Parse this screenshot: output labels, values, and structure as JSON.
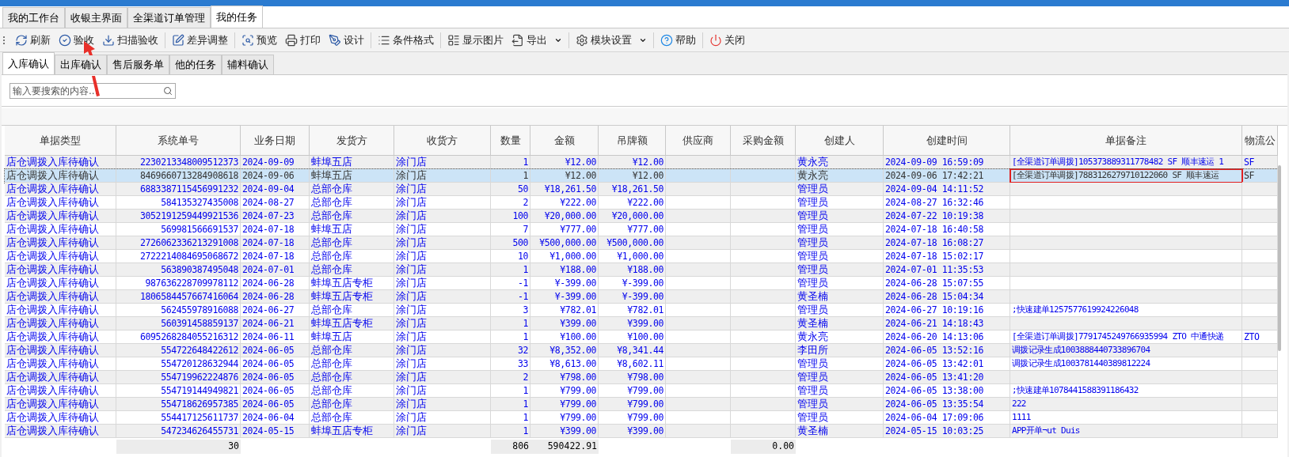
{
  "main_tabs": [
    {
      "label": "我的工作台",
      "selected": false
    },
    {
      "label": "收银主界面",
      "selected": false
    },
    {
      "label": "全渠道订单管理",
      "selected": false
    },
    {
      "label": "我的任务",
      "selected": true
    }
  ],
  "toolbar": [
    {
      "label": "刷新"
    },
    {
      "label": "验收"
    },
    {
      "label": "扫描验收"
    },
    {
      "label": "差异调整"
    },
    {
      "label": "预览"
    },
    {
      "label": "打印"
    },
    {
      "label": "设计"
    },
    {
      "label": "条件格式"
    },
    {
      "label": "显示图片"
    },
    {
      "label": "导出",
      "dropdown": true
    },
    {
      "label": "模块设置",
      "dropdown": true
    },
    {
      "label": "帮助"
    },
    {
      "label": "关闭"
    }
  ],
  "sub_tabs": [
    {
      "label": "入库确认",
      "selected": true
    },
    {
      "label": "出库确认",
      "selected": false
    },
    {
      "label": "售后服务单",
      "selected": false
    },
    {
      "label": "他的任务",
      "selected": false
    },
    {
      "label": "辅料确认",
      "selected": false
    }
  ],
  "search": {
    "placeholder": "输入要搜索的内容..."
  },
  "table": {
    "columns": [
      "单据类型",
      "系统单号",
      "业务日期",
      "发货方",
      "收货方",
      "数量",
      "金额",
      "吊牌额",
      "供应商",
      "采购金额",
      "创建人",
      "创建时间",
      "单据备注",
      "物流公"
    ],
    "rows": [
      {
        "selected": false,
        "cells": [
          "店仓调拨入库待确认",
          "2230213348009512373",
          "2024-09-09",
          "蚌埠五店",
          "涂门店",
          "1",
          "¥12.00",
          "¥12.00",
          null,
          null,
          "黄永亮",
          "2024-09-09 16:59:09",
          "[全渠道订单调拨]105373889311778482 SF 顺丰速运 1",
          "SF"
        ]
      },
      {
        "selected": true,
        "highlight_note": true,
        "cells": [
          "店仓调拨入库待确认",
          "8469660713284908618",
          "2024-09-06",
          "蚌埠五店",
          "涂门店",
          "1",
          "¥12.00",
          "¥12.00",
          null,
          null,
          "黄永亮",
          "2024-09-06 17:42:21",
          "[全渠道订单调拨]7883126279710122060 SF 顺丰速运",
          "SF"
        ]
      },
      {
        "selected": false,
        "cells": [
          "店仓调拨入库待确认",
          "6883387115456991232",
          "2024-09-04",
          "总部仓库",
          "涂门店",
          "50",
          "¥18,261.50",
          "¥18,261.50",
          null,
          null,
          "管理员",
          "2024-09-04 14:11:52",
          null,
          null
        ]
      },
      {
        "selected": false,
        "cells": [
          "店仓调拨入库待确认",
          "584135327435008",
          "2024-08-27",
          "总部仓库",
          "涂门店",
          "2",
          "¥222.00",
          "¥222.00",
          null,
          null,
          "管理员",
          "2024-08-27 16:32:46",
          null,
          null
        ]
      },
      {
        "selected": false,
        "cells": [
          "店仓调拨入库待确认",
          "3052191259449921536",
          "2024-07-23",
          "总部仓库",
          "涂门店",
          "100",
          "¥20,000.00",
          "¥20,000.00",
          null,
          null,
          "管理员",
          "2024-07-22 10:19:38",
          null,
          null
        ]
      },
      {
        "selected": false,
        "cells": [
          "店仓调拨入库待确认",
          "569981566691537",
          "2024-07-18",
          "蚌埠五店",
          "涂门店",
          "7",
          "¥777.00",
          "¥777.00",
          null,
          null,
          "管理员",
          "2024-07-18 16:40:58",
          null,
          null
        ]
      },
      {
        "selected": false,
        "cells": [
          "店仓调拨入库待确认",
          "2726062336213291008",
          "2024-07-18",
          "总部仓库",
          "涂门店",
          "500",
          "¥500,000.00",
          "¥500,000.00",
          null,
          null,
          "管理员",
          "2024-07-18 16:08:27",
          null,
          null
        ]
      },
      {
        "selected": false,
        "cells": [
          "店仓调拨入库待确认",
          "2722214084695068672",
          "2024-07-18",
          "总部仓库",
          "涂门店",
          "10",
          "¥1,000.00",
          "¥1,000.00",
          null,
          null,
          "管理员",
          "2024-07-18 15:02:17",
          null,
          null
        ]
      },
      {
        "selected": false,
        "cells": [
          "店仓调拨入库待确认",
          "563890387495048",
          "2024-07-01",
          "总部仓库",
          "涂门店",
          "1",
          "¥188.00",
          "¥188.00",
          null,
          null,
          "管理员",
          "2024-07-01 11:35:53",
          null,
          null
        ]
      },
      {
        "selected": false,
        "cells": [
          "店仓调拨入库待确认",
          "987636228709978112",
          "2024-06-28",
          "蚌埠五店专柜",
          "涂门店",
          "-1",
          "¥-399.00",
          "¥-399.00",
          null,
          null,
          "管理员",
          "2024-06-28 15:07:55",
          null,
          null
        ]
      },
      {
        "selected": false,
        "cells": [
          "店仓调拨入库待确认",
          "1806584457667416064",
          "2024-06-28",
          "蚌埠五店专柜",
          "涂门店",
          "-1",
          "¥-399.00",
          "¥-399.00",
          null,
          null,
          "黄圣楠",
          "2024-06-28 15:04:34",
          null,
          null
        ]
      },
      {
        "selected": false,
        "cells": [
          "店仓调拨入库待确认",
          "562455978916088",
          "2024-06-27",
          "总部仓库",
          "涂门店",
          "3",
          "¥782.01",
          "¥782.01",
          null,
          null,
          "管理员",
          "2024-06-27 10:19:16",
          ";快速建单1257577619924226048",
          null
        ]
      },
      {
        "selected": false,
        "cells": [
          "店仓调拨入库待确认",
          "560391458859137",
          "2024-06-21",
          "蚌埠五店专柜",
          "涂门店",
          "1",
          "¥399.00",
          "¥399.00",
          null,
          null,
          "黄圣楠",
          "2024-06-21 14:18:43",
          null,
          null
        ]
      },
      {
        "selected": false,
        "cells": [
          "店仓调拨入库待确认",
          "6095268284055216312",
          "2024-06-11",
          "蚌埠五店",
          "涂门店",
          "1",
          "¥100.00",
          "¥100.00",
          null,
          null,
          "黄永亮",
          "2024-06-20 14:13:06",
          "[全渠道订单调拨]7791745249766935994 ZTO 中通快递",
          "ZTO"
        ]
      },
      {
        "selected": false,
        "cells": [
          "店仓调拨入库待确认",
          "554722648422612",
          "2024-06-05",
          "总部仓库",
          "涂门店",
          "32",
          "¥8,352.00",
          "¥8,341.44",
          null,
          null,
          "李田所",
          "2024-06-05 13:52:16",
          "调拨记录生成1003888440733896704",
          null
        ]
      },
      {
        "selected": false,
        "cells": [
          "店仓调拨入库待确认",
          "554720128632944",
          "2024-06-05",
          "总部仓库",
          "涂门店",
          "33",
          "¥8,613.00",
          "¥8,602.11",
          null,
          null,
          "管理员",
          "2024-06-05 13:42:01",
          "调拨记录生成1003781440389812224",
          null
        ]
      },
      {
        "selected": false,
        "cells": [
          "店仓调拨入库待确认",
          "554719962224876",
          "2024-06-05",
          "总部仓库",
          "涂门店",
          "2",
          "¥798.00",
          "¥798.00",
          null,
          null,
          "管理员",
          "2024-06-05 13:41:20",
          null,
          null
        ]
      },
      {
        "selected": false,
        "cells": [
          "店仓调拨入库待确认",
          "554719144949821",
          "2024-06-05",
          "总部仓库",
          "涂门店",
          "1",
          "¥799.00",
          "¥799.00",
          null,
          null,
          "管理员",
          "2024-06-05 13:38:00",
          ";快速建单1078441588391186432",
          null
        ]
      },
      {
        "selected": false,
        "cells": [
          "店仓调拨入库待确认",
          "554718626957385",
          "2024-06-05",
          "总部仓库",
          "涂门店",
          "1",
          "¥799.00",
          "¥799.00",
          null,
          null,
          "管理员",
          "2024-06-05 13:35:54",
          "222",
          null
        ]
      },
      {
        "selected": false,
        "cells": [
          "店仓调拨入库待确认",
          "554417125611737",
          "2024-06-04",
          "总部仓库",
          "涂门店",
          "1",
          "¥799.00",
          "¥799.00",
          null,
          null,
          "管理员",
          "2024-06-04 17:09:06",
          "1111",
          null
        ]
      },
      {
        "selected": false,
        "cells": [
          "店仓调拨入库待确认",
          "547234626455731",
          "2024-05-15",
          "蚌埠五店专柜",
          "涂门店",
          "1",
          "¥399.00",
          "¥399.00",
          null,
          null,
          "黄圣楠",
          "2024-05-15 10:03:25",
          "APP开单¬ut Duis",
          null
        ]
      }
    ],
    "totals": [
      "30",
      "806",
      "590422.91",
      "0.00"
    ]
  }
}
